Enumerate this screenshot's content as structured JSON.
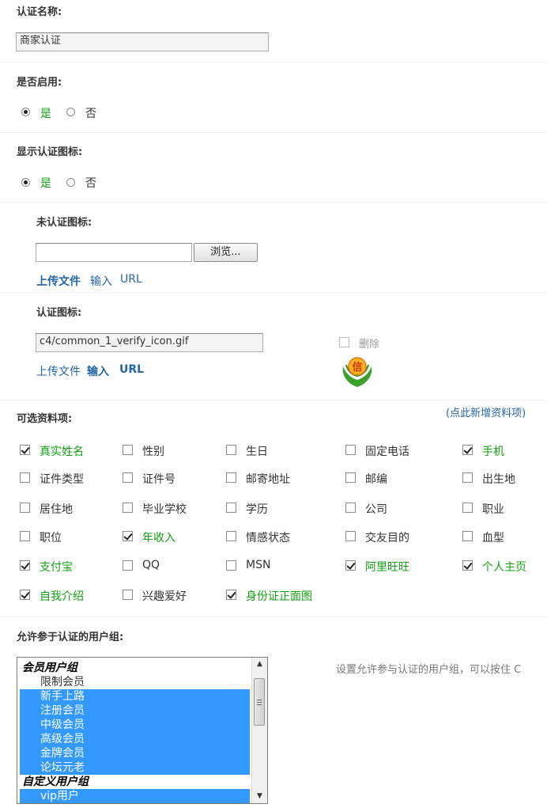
{
  "auth_name": {
    "label": "认证名称:",
    "value": "商家认证"
  },
  "enabled": {
    "label": "是否启用:",
    "yes": "是",
    "no": "否",
    "selected": "yes"
  },
  "show_icon": {
    "label": "显示认证图标:",
    "yes": "是",
    "no": "否",
    "selected": "yes"
  },
  "unverified_icon": {
    "label": "未认证图标:",
    "value": "",
    "browse": "浏览...",
    "upload": "上传文件",
    "input": "输入",
    "url": "URL"
  },
  "verified_icon": {
    "label": "认证图标:",
    "value": "c4/common_1_verify_icon.gif",
    "delete": "删除",
    "upload": "上传文件",
    "input": "输入",
    "url": "URL",
    "icon_char": "信"
  },
  "fields": {
    "label": "可选资料项:",
    "add_link": "(点此新增资料项)",
    "items": [
      {
        "label": "真实姓名",
        "checked": true
      },
      {
        "label": "性别",
        "checked": false
      },
      {
        "label": "生日",
        "checked": false
      },
      {
        "label": "固定电话",
        "checked": false
      },
      {
        "label": "手机",
        "checked": true
      },
      {
        "label": "证件类型",
        "checked": false
      },
      {
        "label": "证件号",
        "checked": false
      },
      {
        "label": "邮寄地址",
        "checked": false
      },
      {
        "label": "邮编",
        "checked": false
      },
      {
        "label": "出生地",
        "checked": false
      },
      {
        "label": "居住地",
        "checked": false
      },
      {
        "label": "毕业学校",
        "checked": false
      },
      {
        "label": "学历",
        "checked": false
      },
      {
        "label": "公司",
        "checked": false
      },
      {
        "label": "职业",
        "checked": false
      },
      {
        "label": "职位",
        "checked": false
      },
      {
        "label": "年收入",
        "checked": true
      },
      {
        "label": "情感状态",
        "checked": false
      },
      {
        "label": "交友目的",
        "checked": false
      },
      {
        "label": "血型",
        "checked": false
      },
      {
        "label": "支付宝",
        "checked": true
      },
      {
        "label": "QQ",
        "checked": false
      },
      {
        "label": "MSN",
        "checked": false
      },
      {
        "label": "阿里旺旺",
        "checked": true
      },
      {
        "label": "个人主页",
        "checked": true
      },
      {
        "label": "自我介绍",
        "checked": true
      },
      {
        "label": "兴趣爱好",
        "checked": false
      },
      {
        "label": "身份证正面图",
        "checked": true
      }
    ]
  },
  "groups": {
    "label": "允许参于认证的用户组:",
    "hint": "设置允许参与认证的用户组，可以按住 C",
    "options": [
      {
        "label": "会员用户组",
        "group": true,
        "selected": false
      },
      {
        "label": "限制会员",
        "group": false,
        "selected": false
      },
      {
        "label": "新手上路",
        "group": false,
        "selected": true
      },
      {
        "label": "注册会员",
        "group": false,
        "selected": true
      },
      {
        "label": "中级会员",
        "group": false,
        "selected": true
      },
      {
        "label": "高级会员",
        "group": false,
        "selected": true
      },
      {
        "label": "金牌会员",
        "group": false,
        "selected": true
      },
      {
        "label": "论坛元老",
        "group": false,
        "selected": true
      },
      {
        "label": "自定义用户组",
        "group": true,
        "selected": false
      },
      {
        "label": "vip用户",
        "group": false,
        "selected": true
      }
    ]
  }
}
